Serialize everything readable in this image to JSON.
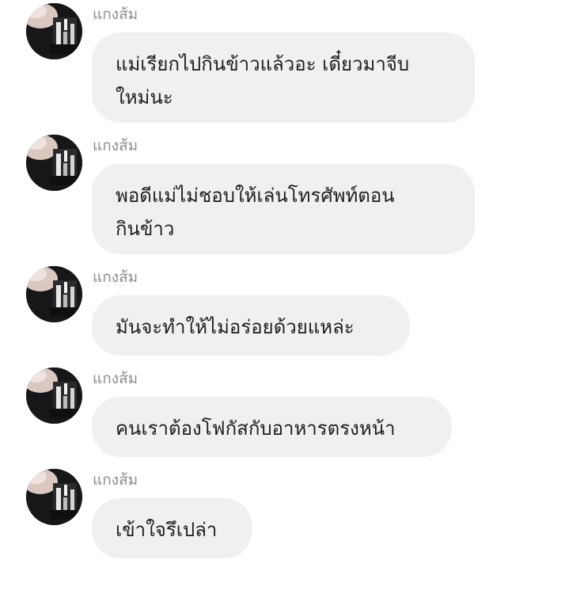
{
  "messages": [
    {
      "sender": "แกงส้ม",
      "text": "แม่เรียกไปกินข้าวแล้วอะ เดี๋ยวมาจีบ\nใหม่นะ"
    },
    {
      "sender": "แกงส้ม",
      "text": "พอดีแม่ไม่ชอบให้เล่นโทรศัพท์ตอน\nกินข้าว"
    },
    {
      "sender": "แกงส้ม",
      "text": "มันจะทำให้ไม่อร่อยด้วยแหล่ะ"
    },
    {
      "sender": "แกงส้ม",
      "text": "คนเราต้องโฟกัสกับอาหารตรงหน้า"
    },
    {
      "sender": "แกงส้ม",
      "text": "เข้าใจรึเปล่า"
    }
  ],
  "colors": {
    "bubble_bg": "#f0f0f0",
    "sender_text": "#8a8d91",
    "message_text": "#1c1e21"
  },
  "icons": {
    "avatar": "profile-photo"
  }
}
